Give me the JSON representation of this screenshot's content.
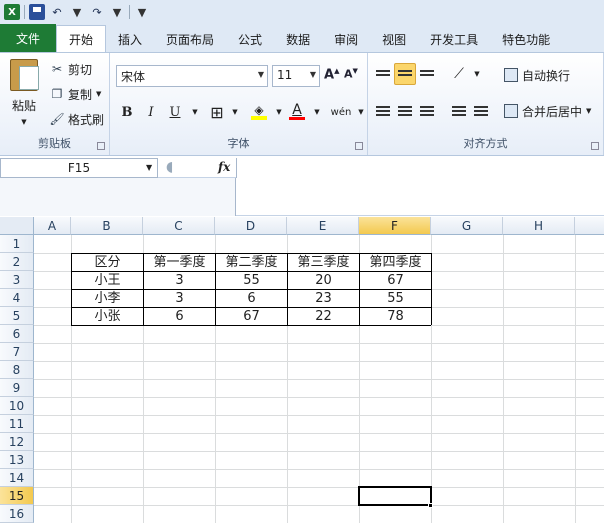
{
  "tabs": [
    "文件",
    "开始",
    "插入",
    "页面布局",
    "公式",
    "数据",
    "审阅",
    "视图",
    "开发工具",
    "特色功能"
  ],
  "clipboard": {
    "paste": "粘贴",
    "cut": "剪切",
    "copy": "复制",
    "format_painter": "格式刷",
    "group": "剪贴板"
  },
  "font": {
    "name": "宋体",
    "size": "11",
    "bold": "B",
    "italic": "I",
    "underline": "U",
    "group": "字体"
  },
  "alignment": {
    "wrap": "自动换行",
    "merge": "合并后居中",
    "group": "对齐方式"
  },
  "formula_bar": {
    "name_box": "F15",
    "fx": "fx"
  },
  "columns": [
    "A",
    "B",
    "C",
    "D",
    "E",
    "F",
    "G",
    "H"
  ],
  "rows": [
    "1",
    "2",
    "3",
    "4",
    "5",
    "6",
    "7",
    "8",
    "9",
    "10",
    "11",
    "12",
    "13",
    "14",
    "15",
    "16"
  ],
  "selected_col": "F",
  "selected_row": "15",
  "table": {
    "header": [
      "区分",
      "第一季度",
      "第二季度",
      "第三季度",
      "第四季度"
    ],
    "rows": [
      [
        "小王",
        "3",
        "55",
        "20",
        "67"
      ],
      [
        "小李",
        "3",
        "6",
        "23",
        "55"
      ],
      [
        "小张",
        "6",
        "67",
        "22",
        "78"
      ]
    ]
  }
}
